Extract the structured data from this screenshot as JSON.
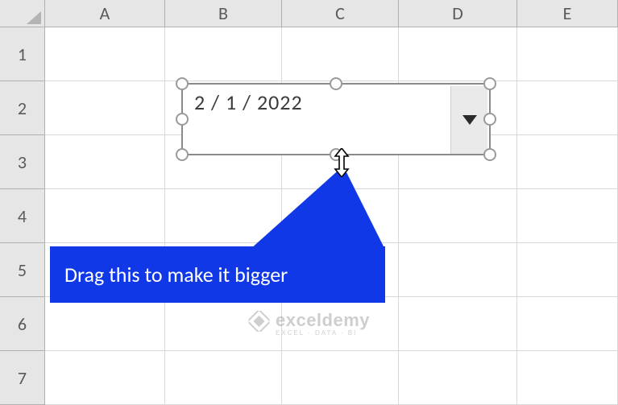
{
  "columns": [
    {
      "label": "A",
      "width": 149
    },
    {
      "label": "B",
      "width": 145
    },
    {
      "label": "C",
      "width": 145
    },
    {
      "label": "D",
      "width": 147
    },
    {
      "label": "E",
      "width": 125
    }
  ],
  "rows": [
    {
      "label": "1",
      "height": 67
    },
    {
      "label": "2",
      "height": 67
    },
    {
      "label": "3",
      "height": 67
    },
    {
      "label": "4",
      "height": 67
    },
    {
      "label": "5",
      "height": 67
    },
    {
      "label": "6",
      "height": 67
    },
    {
      "label": "7",
      "height": 67
    }
  ],
  "datepicker": {
    "value": "2 / 1 / 2022"
  },
  "callout": {
    "text": "Drag this to make it bigger"
  },
  "watermark": {
    "brand": "exceldemy",
    "tag": "EXCEL · DATA · BI"
  },
  "colors": {
    "callout": "#1038e6",
    "header_bg": "#e6e6e6",
    "grid_line": "#d8d8d8"
  }
}
